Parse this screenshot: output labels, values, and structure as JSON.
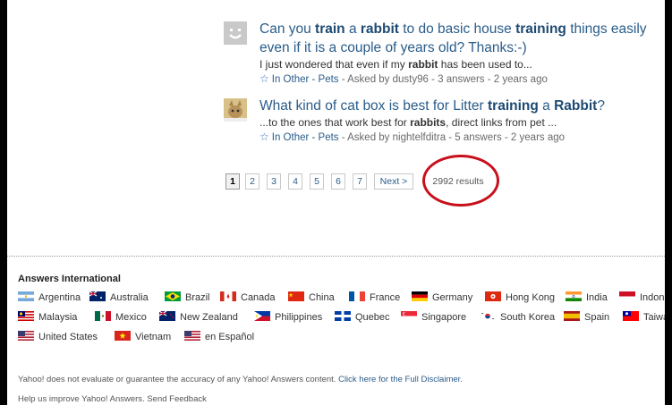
{
  "results": [
    {
      "title_pre": "Can you ",
      "title_b1": "train",
      "title_mid1": " a ",
      "title_b2": "rabbit",
      "title_mid2": " to do basic house ",
      "title_b3": "training",
      "title_post": " things easily even if it is a couple of years old? Thanks:-)",
      "snippet_pre": "I just wondered that even if my ",
      "snippet_b": "rabbit",
      "snippet_post": " has been used to...",
      "meta_cat": "In Other - Pets",
      "meta_rest": " - Asked by dusty96 - 3 answers - 2 years ago",
      "thumb_icon": "smiley-avatar-icon"
    },
    {
      "title_pre": "What kind of cat box is best for Litter ",
      "title_b1": "training",
      "title_mid1": " a ",
      "title_b2": "Rabbit",
      "title_post": "?",
      "snippet_pre": "...to the ones that work best for ",
      "snippet_b": "rabbits",
      "snippet_post": ", direct links from pet ...",
      "meta_cat": "In Other - Pets",
      "meta_rest": " - Asked by nightelfditra - 5 answers - 2 years ago",
      "thumb_icon": "cat-avatar-icon"
    }
  ],
  "pagination": {
    "pages": [
      "1",
      "2",
      "3",
      "4",
      "5",
      "6",
      "7"
    ],
    "current": "1",
    "next": "Next >",
    "results_count": "2992 results"
  },
  "international": {
    "title": "Answers International",
    "countries": [
      {
        "name": "Argentina",
        "flag_icon": "argentina-flag-icon"
      },
      {
        "name": "Australia",
        "flag_icon": "australia-flag-icon"
      },
      {
        "name": "Brazil",
        "flag_icon": "brazil-flag-icon"
      },
      {
        "name": "Canada",
        "flag_icon": "canada-flag-icon"
      },
      {
        "name": "China",
        "flag_icon": "china-flag-icon"
      },
      {
        "name": "France",
        "flag_icon": "france-flag-icon"
      },
      {
        "name": "Germany",
        "flag_icon": "germany-flag-icon"
      },
      {
        "name": "Hong Kong",
        "flag_icon": "hong-kong-flag-icon"
      },
      {
        "name": "India",
        "flag_icon": "india-flag-icon"
      },
      {
        "name": "Indonesia",
        "flag_icon": "indonesia-flag-icon"
      },
      {
        "name": "Malaysia",
        "flag_icon": "malaysia-flag-icon"
      },
      {
        "name": "Mexico",
        "flag_icon": "mexico-flag-icon"
      },
      {
        "name": "New Zealand",
        "flag_icon": "new-zealand-flag-icon"
      },
      {
        "name": "Philippines",
        "flag_icon": "philippines-flag-icon"
      },
      {
        "name": "Quebec",
        "flag_icon": "quebec-flag-icon"
      },
      {
        "name": "Singapore",
        "flag_icon": "singapore-flag-icon"
      },
      {
        "name": "South Korea",
        "flag_icon": "south-korea-flag-icon"
      },
      {
        "name": "Spain",
        "flag_icon": "spain-flag-icon"
      },
      {
        "name": "Taiwan",
        "flag_icon": "taiwan-flag-icon"
      },
      {
        "name": "United States",
        "flag_icon": "united-states-flag-icon"
      },
      {
        "name": "Vietnam",
        "flag_icon": "vietnam-flag-icon"
      },
      {
        "name": "en Español",
        "flag_icon": "en-espanol-flag-icon"
      }
    ]
  },
  "footer": {
    "disclaimer_text": "Yahoo! does not evaluate or guarantee the accuracy of any Yahoo! Answers content. ",
    "disclaimer_link": "Click here for the Full Disclaimer",
    "disclaimer_end": ".",
    "feedback": "Help us improve Yahoo! Answers. Send Feedback"
  },
  "colors": {
    "link": "#2a5c8a",
    "highlight_circle": "#c8101c"
  }
}
